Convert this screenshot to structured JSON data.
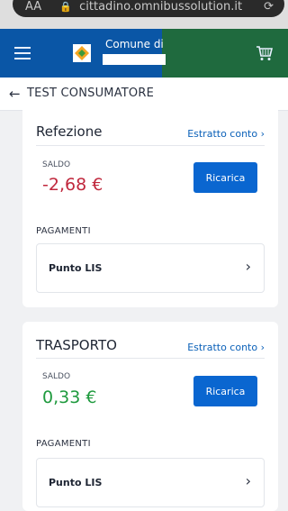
{
  "browser": {
    "aa_label": "AA",
    "url": "cittadino.omnibussolution.it",
    "icons": {
      "lock": "lock-icon",
      "reload": "reload-icon"
    }
  },
  "header": {
    "title": "Comune di",
    "colors": {
      "blue": "#0a56a6",
      "green": "#1f6a3e",
      "teal": "#0d6a74"
    },
    "icons": {
      "menu": "hamburger-icon",
      "logo": "comune-logo-icon",
      "cart": "cart-icon"
    }
  },
  "page": {
    "back_icon": "arrow-left-icon",
    "title": "TEST CONSUMATORE"
  },
  "services": [
    {
      "name": "Refezione",
      "statement_link": "Estratto conto ›",
      "balance_label": "SALDO",
      "balance": "-2,68 €",
      "balance_color": "#c0283d",
      "recharge_label": "Ricarica",
      "payments_label": "PAGAMENTI",
      "payment_method": "Punto LIS"
    },
    {
      "name": "TRASPORTO",
      "statement_link": "Estratto conto ›",
      "balance_label": "SALDO",
      "balance": "0,33 €",
      "balance_color": "#1f9a3e",
      "recharge_label": "Ricarica",
      "payments_label": "PAGAMENTI",
      "payment_method": "Punto LIS"
    }
  ],
  "accent_color": "#0a66d0"
}
